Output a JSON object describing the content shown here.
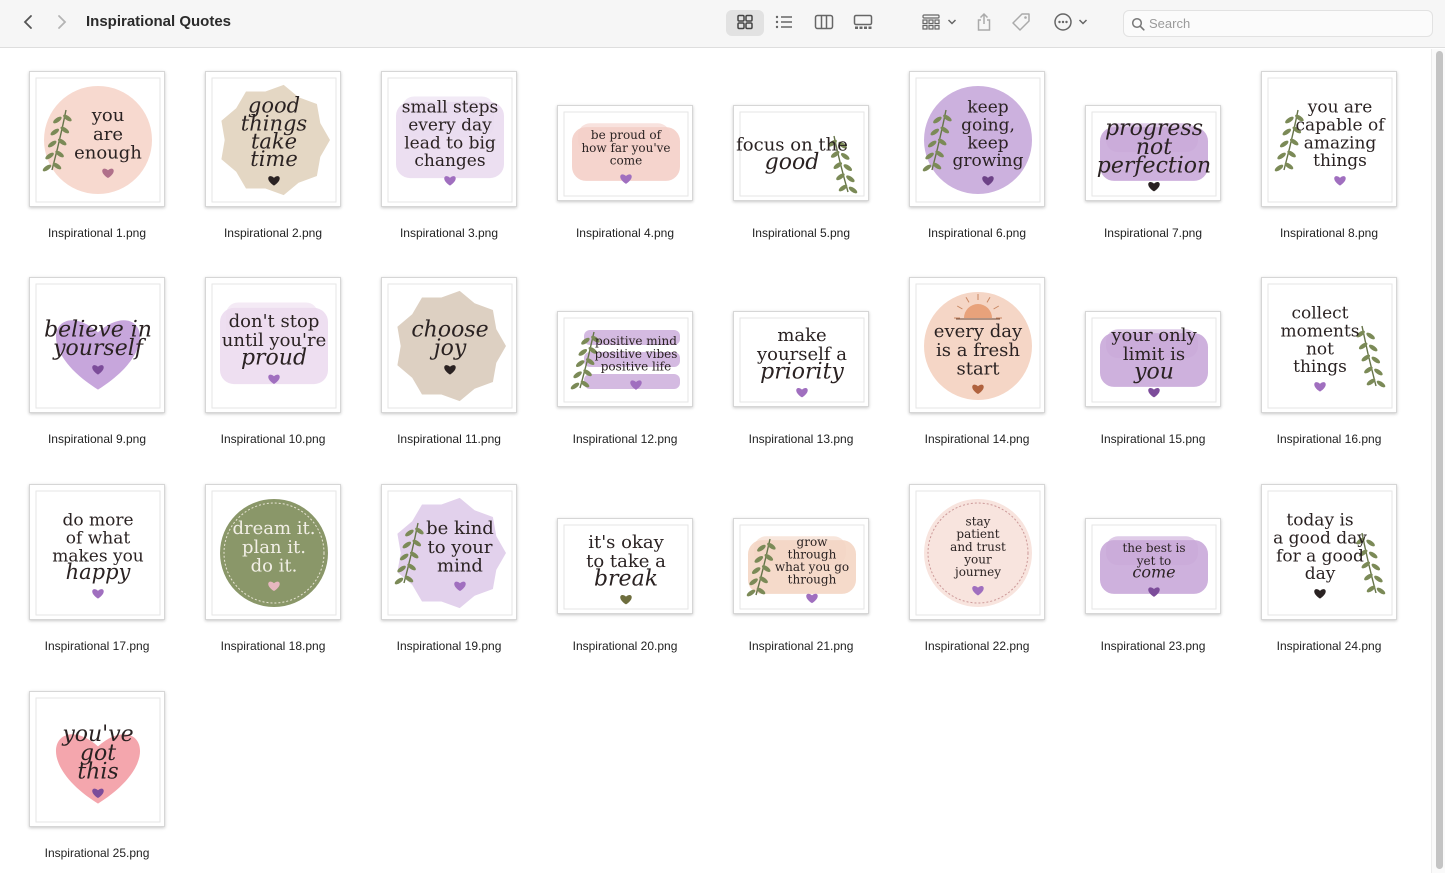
{
  "window": {
    "title": "Inspirational Quotes"
  },
  "toolbar": {
    "back_icon": "chevron-left-icon",
    "forward_icon": "chevron-right-icon",
    "view_modes": [
      "icon-view-icon",
      "list-view-icon",
      "column-view-icon",
      "gallery-view-icon"
    ],
    "active_view": "icon-view-icon",
    "group_icon": "group-by-icon",
    "share_icon": "share-icon",
    "tag_icon": "tag-icon",
    "more_icon": "more-actions-icon",
    "search": {
      "placeholder": "Search",
      "value": ""
    }
  },
  "colors": {
    "accent_heart": "#9b6bb8",
    "dark_heart": "#3a2a2a"
  },
  "files": [
    {
      "name": "Inspirational 1.png",
      "bg": "circle",
      "color": "#f7d9cf",
      "lines": [
        "you",
        "are",
        "enough"
      ],
      "leaf": "left",
      "heart": "#b0708a"
    },
    {
      "name": "Inspirational 2.png",
      "bg": "flower",
      "color": "#e4d7c4",
      "lines": [
        "good",
        "things",
        "take",
        "time"
      ],
      "script": true,
      "heart": "#2a2222"
    },
    {
      "name": "Inspirational 3.png",
      "bg": "wash",
      "color": "#eadcf0",
      "lines": [
        "small steps",
        "every day",
        "lead to big",
        "changes"
      ],
      "heart": "#a06fbf"
    },
    {
      "name": "Inspirational 4.png",
      "bg": "wash",
      "color": "#f4cfc8",
      "lines": [
        "be proud of",
        "how far you've",
        "come"
      ],
      "heart": "#a06fbf",
      "small": true
    },
    {
      "name": "Inspirational 5.png",
      "bg": "none",
      "color": "#ffffff",
      "lines": [
        "focus on the",
        "good"
      ],
      "script_last": true,
      "leaf": "right",
      "heart": ""
    },
    {
      "name": "Inspirational 6.png",
      "bg": "circle",
      "color": "#ccb1de",
      "lines": [
        "keep",
        "going,",
        "keep",
        "growing"
      ],
      "leaf": "left",
      "heart": "#6d4287"
    },
    {
      "name": "Inspirational 7.png",
      "bg": "wash",
      "color": "#c9a9d9",
      "lines": [
        "progress",
        "not",
        "perfection"
      ],
      "script": true,
      "heart": "#2a2222"
    },
    {
      "name": "Inspirational 8.png",
      "bg": "none",
      "color": "#ffffff",
      "lines": [
        "you are",
        "capable of",
        "amazing",
        "things"
      ],
      "leaf": "left",
      "heart": "#a06fbf"
    },
    {
      "name": "Inspirational 9.png",
      "bg": "heart",
      "color": "#c7a6dc",
      "lines": [
        "believe in",
        "yourself"
      ],
      "script": true,
      "heart": "#7c4c9a"
    },
    {
      "name": "Inspirational 10.png",
      "bg": "wash",
      "color": "#ecdcef",
      "lines": [
        "don't stop",
        "until you're",
        "proud"
      ],
      "script_last": true,
      "heart": "#a06fbf"
    },
    {
      "name": "Inspirational 11.png",
      "bg": "flower",
      "color": "#ddd0c2",
      "lines": [
        "choose",
        "joy"
      ],
      "script": true,
      "heart": "#2a2222"
    },
    {
      "name": "Inspirational 12.png",
      "bg": "stripes",
      "color": "#c9a9d9",
      "lines": [
        "positive mind",
        "positive vibes",
        "positive life"
      ],
      "leaf": "left",
      "heart": "#a06fbf",
      "small": true
    },
    {
      "name": "Inspirational 13.png",
      "bg": "none",
      "color": "#ffffff",
      "lines": [
        "make",
        "yourself a",
        "priority"
      ],
      "script_last": true,
      "heart": "#a06fbf"
    },
    {
      "name": "Inspirational 14.png",
      "bg": "circle",
      "color": "#f5d6c6",
      "lines": [
        "every day",
        "is a fresh",
        "start"
      ],
      "sun": true,
      "heart": "#b0623e"
    },
    {
      "name": "Inspirational 15.png",
      "bg": "wash",
      "color": "#c9a9d9",
      "lines": [
        "your only",
        "limit is",
        "you"
      ],
      "script_last": true,
      "heart": "#7c4c9a"
    },
    {
      "name": "Inspirational 16.png",
      "bg": "none",
      "color": "#ffffff",
      "lines": [
        "collect",
        "moments",
        "not",
        "things"
      ],
      "leaf": "right",
      "heart": "#a06fbf"
    },
    {
      "name": "Inspirational 17.png",
      "bg": "none",
      "color": "#ffffff",
      "lines": [
        "do more",
        "of what",
        "makes you",
        "happy"
      ],
      "script_last": true,
      "heart": "#a06fbf"
    },
    {
      "name": "Inspirational 18.png",
      "bg": "circle",
      "color": "#8a9769",
      "lines": [
        "dream it.",
        "plan it.",
        "do it."
      ],
      "light": true,
      "heart": "#e7b7c0"
    },
    {
      "name": "Inspirational 19.png",
      "bg": "flower",
      "color": "#e2d1ec",
      "lines": [
        "be kind",
        "to your",
        "mind"
      ],
      "leaf": "left",
      "heart": "#a06fbf"
    },
    {
      "name": "Inspirational 20.png",
      "bg": "none",
      "color": "#ffffff",
      "lines": [
        "it's okay",
        "to take a",
        "break"
      ],
      "script_last": true,
      "heart": "#6e6e3e"
    },
    {
      "name": "Inspirational 21.png",
      "bg": "wash",
      "color": "#f4d6c4",
      "lines": [
        "grow",
        "through",
        "what you go",
        "through"
      ],
      "leaf": "left",
      "heart": "#a06fbf",
      "small": true
    },
    {
      "name": "Inspirational 22.png",
      "bg": "circle",
      "color": "#f8e4de",
      "lines": [
        "stay",
        "patient",
        "and trust",
        "your",
        "journey"
      ],
      "dashed": true,
      "heart": "#a06fbf",
      "small": true
    },
    {
      "name": "Inspirational 23.png",
      "bg": "wash",
      "color": "#c9a9d9",
      "lines": [
        "the best is",
        "yet to",
        "come"
      ],
      "script_last": true,
      "heart": "#7c4c9a",
      "small": true
    },
    {
      "name": "Inspirational 24.png",
      "bg": "none",
      "color": "#ffffff",
      "lines": [
        "today is",
        "a good day",
        "for a good",
        "day"
      ],
      "leaf": "right",
      "heart": "#2a2222"
    },
    {
      "name": "Inspirational 25.png",
      "bg": "heart",
      "color": "#f4a6ad",
      "lines": [
        "you've",
        "got",
        "this"
      ],
      "script": true,
      "heart": "#7c4c9a"
    }
  ]
}
